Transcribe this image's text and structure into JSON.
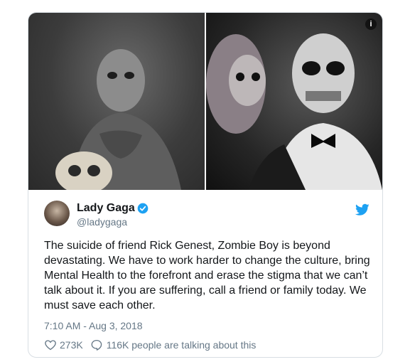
{
  "tweet": {
    "name": "Lady Gaga",
    "handle": "@ladygaga",
    "text": "The suicide of friend Rick Genest, Zombie Boy is beyond devastating. We have to work harder to change the culture, bring Mental Health to the forefront and erase the stigma that we can’t talk about it. If you are suffering, call a friend or family today. We must save each other.",
    "timestamp": "7:10 AM - Aug 3, 2018",
    "likes": "273K",
    "talking": "116K people are talking about this"
  },
  "media": {
    "info_icon": "i"
  },
  "icons": {
    "verified": "verified-badge-icon",
    "twitter": "twitter-bird-icon",
    "like": "heart-icon",
    "reply": "speech-bubble-icon"
  },
  "colors": {
    "twitter_blue": "#1da1f2",
    "secondary_text": "#657786",
    "border": "#d8dee3"
  }
}
